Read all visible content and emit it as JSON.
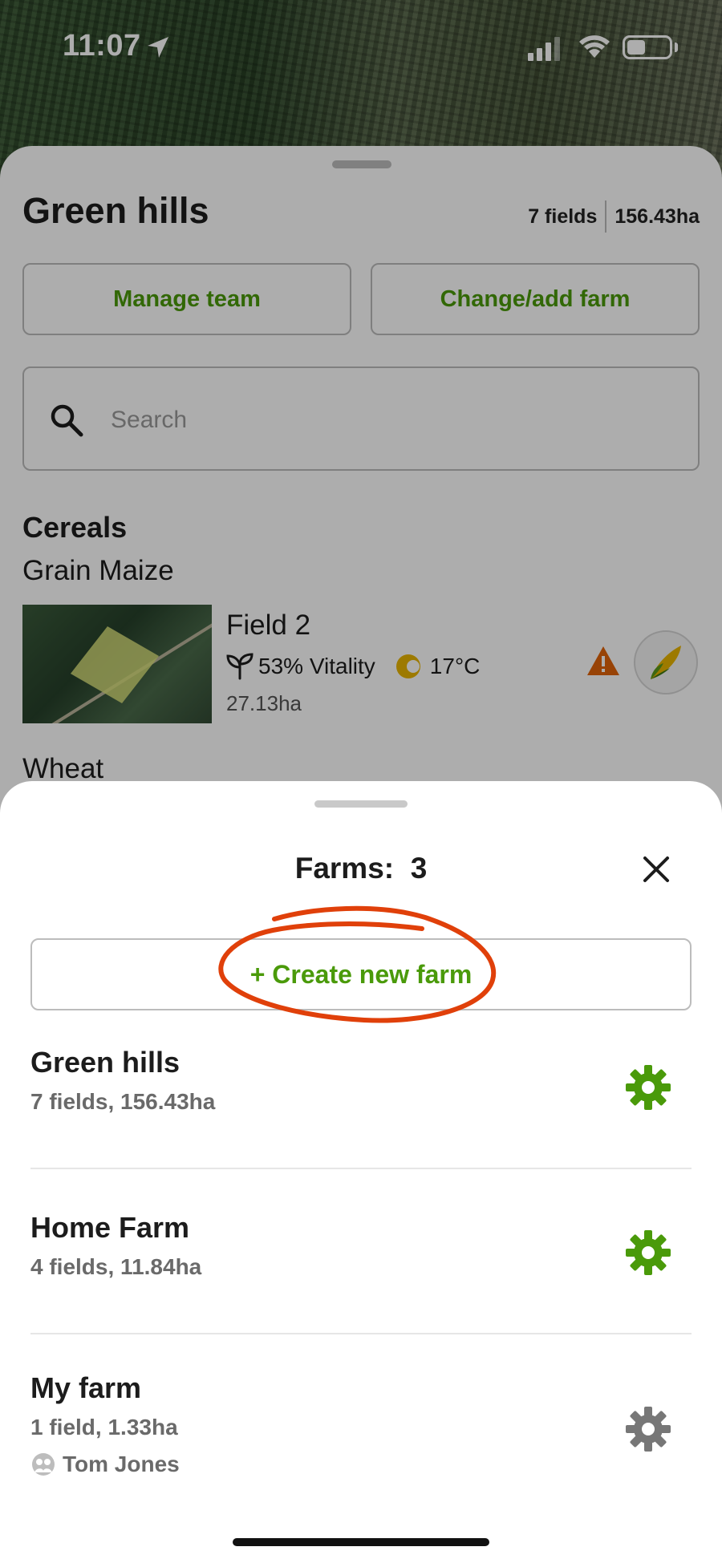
{
  "status_bar": {
    "time": "11:07"
  },
  "farm_header": {
    "title": "Green hills",
    "fields": "7 fields",
    "area": "156.43ha"
  },
  "buttons": {
    "manage_team": "Manage team",
    "change_farm": "Change/add farm"
  },
  "search": {
    "placeholder": "Search",
    "value": ""
  },
  "field_list": {
    "group": "Cereals",
    "crop": "Grain Maize",
    "field": {
      "name": "Field 2",
      "vitality": "53% Vitality",
      "temperature": "17°C",
      "area": "27.13ha"
    },
    "next_crop": "Wheat"
  },
  "farms_sheet": {
    "title_label": "Farms:",
    "count": "3",
    "create_label": "+ Create new farm",
    "farms": [
      {
        "name": "Green hills",
        "meta": "7 fields, 156.43ha",
        "gear_color": "#4a9a0a"
      },
      {
        "name": "Home Farm",
        "meta": "4 fields, 11.84ha",
        "gear_color": "#4a9a0a"
      },
      {
        "name": "My farm",
        "meta": "1 field, 1.33ha",
        "owner": "Tom Jones",
        "gear_color": "#777777"
      }
    ]
  },
  "colors": {
    "accent": "#4a9a0a",
    "annotation": "#e0400a",
    "warning": "#e0640a"
  }
}
